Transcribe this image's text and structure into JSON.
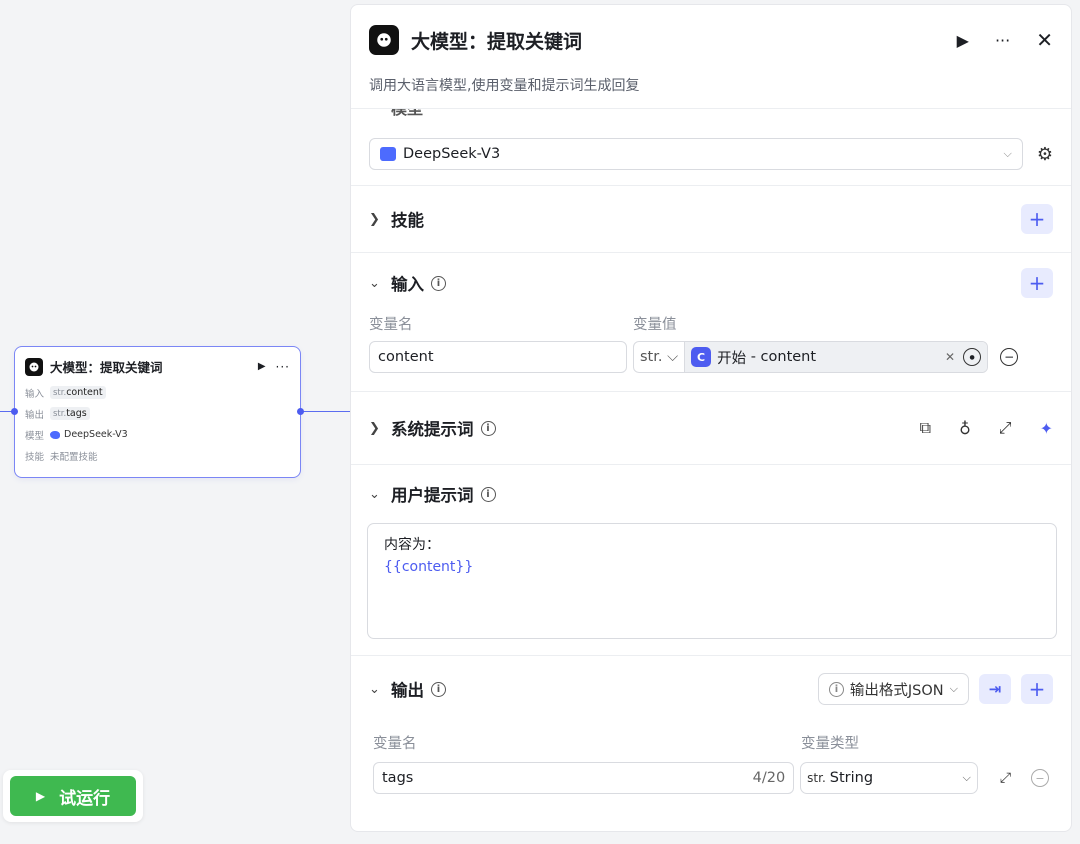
{
  "canvas": {
    "node": {
      "title": "大模型：提取关键词",
      "rows": [
        {
          "key": "输入",
          "type": "str.",
          "value": "content"
        },
        {
          "key": "输出",
          "type": "str.",
          "value": "tags"
        },
        {
          "key": "模型",
          "value": "DeepSeek-V3"
        },
        {
          "key": "技能",
          "value": "未配置技能"
        }
      ]
    },
    "trial_button": "试运行"
  },
  "panel": {
    "title": "大模型：提取关键词",
    "description": "调用大语言模型,使用变量和提示词生成回复",
    "model_section": {
      "title": "模型",
      "selected": "DeepSeek-V3"
    },
    "skills_section": {
      "title": "技能"
    },
    "input_section": {
      "title": "输入",
      "col_name": "变量名",
      "col_value": "变量值",
      "row": {
        "name": "content",
        "type": "str.",
        "source": "开始",
        "separator": " - ",
        "source_var": "content"
      }
    },
    "system_prompt": {
      "title": "系统提示词"
    },
    "user_prompt": {
      "title": "用户提示词",
      "line1": "内容为：",
      "line2": "{{content}}"
    },
    "output_section": {
      "title": "输出",
      "format": "输出格式JSON",
      "col_name": "变量名",
      "col_type": "变量类型",
      "row": {
        "name": "tags",
        "counter": "4/20",
        "type_prefix": "str.",
        "type": "String"
      }
    }
  },
  "colors": {
    "accent": "#4d5cf0",
    "run_green": "#3fb950"
  }
}
